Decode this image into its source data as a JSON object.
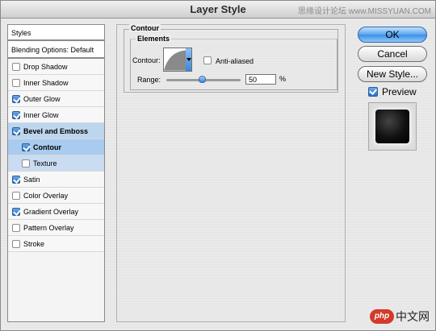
{
  "window": {
    "title": "Layer Style"
  },
  "watermark": {
    "top": "思缘设计论坛 www.MISSYUAN.COM",
    "logo": "php",
    "bottom": "中文网"
  },
  "sidebar": {
    "header": "Styles",
    "blending": "Blending Options: Default",
    "items": [
      {
        "label": "Drop Shadow",
        "checked": false
      },
      {
        "label": "Inner Shadow",
        "checked": false
      },
      {
        "label": "Outer Glow",
        "checked": true
      },
      {
        "label": "Inner Glow",
        "checked": true
      },
      {
        "label": "Bevel and Emboss",
        "checked": true
      },
      {
        "label": "Contour",
        "checked": true
      },
      {
        "label": "Texture",
        "checked": false
      },
      {
        "label": "Satin",
        "checked": true
      },
      {
        "label": "Color Overlay",
        "checked": false
      },
      {
        "label": "Gradient Overlay",
        "checked": true
      },
      {
        "label": "Pattern Overlay",
        "checked": false
      },
      {
        "label": "Stroke",
        "checked": false
      }
    ]
  },
  "contour": {
    "section_title": "Contour",
    "elements_title": "Elements",
    "contour_label": "Contour:",
    "anti_aliased_label": "Anti-aliased",
    "range_label": "Range:",
    "range_value": "50",
    "range_unit": "%"
  },
  "buttons": {
    "ok": "OK",
    "cancel": "Cancel",
    "new_style": "New Style...",
    "preview": "Preview"
  }
}
